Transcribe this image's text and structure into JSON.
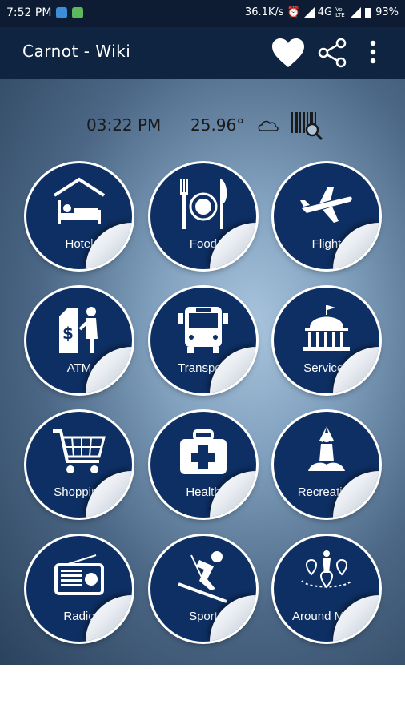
{
  "status": {
    "time": "7:52 PM",
    "speed": "36.1K/s",
    "network": "4G",
    "volte": "Vo LTE",
    "battery": "93%"
  },
  "appbar": {
    "title": "Carnot - Wiki"
  },
  "info": {
    "time": "03:22 PM",
    "temperature": "25.96°"
  },
  "tiles": [
    {
      "label": "Hotel"
    },
    {
      "label": "Food"
    },
    {
      "label": "Flight"
    },
    {
      "label": "ATM"
    },
    {
      "label": "Transport"
    },
    {
      "label": "Services"
    },
    {
      "label": "Shopping"
    },
    {
      "label": "Health"
    },
    {
      "label": "Recreation"
    },
    {
      "label": "Radio"
    },
    {
      "label": "Sport"
    },
    {
      "label": "Around Me ?"
    }
  ],
  "colors": {
    "tile": "#0e2f63",
    "appbar": "#0f2440",
    "statusbar": "#0d1c33"
  }
}
